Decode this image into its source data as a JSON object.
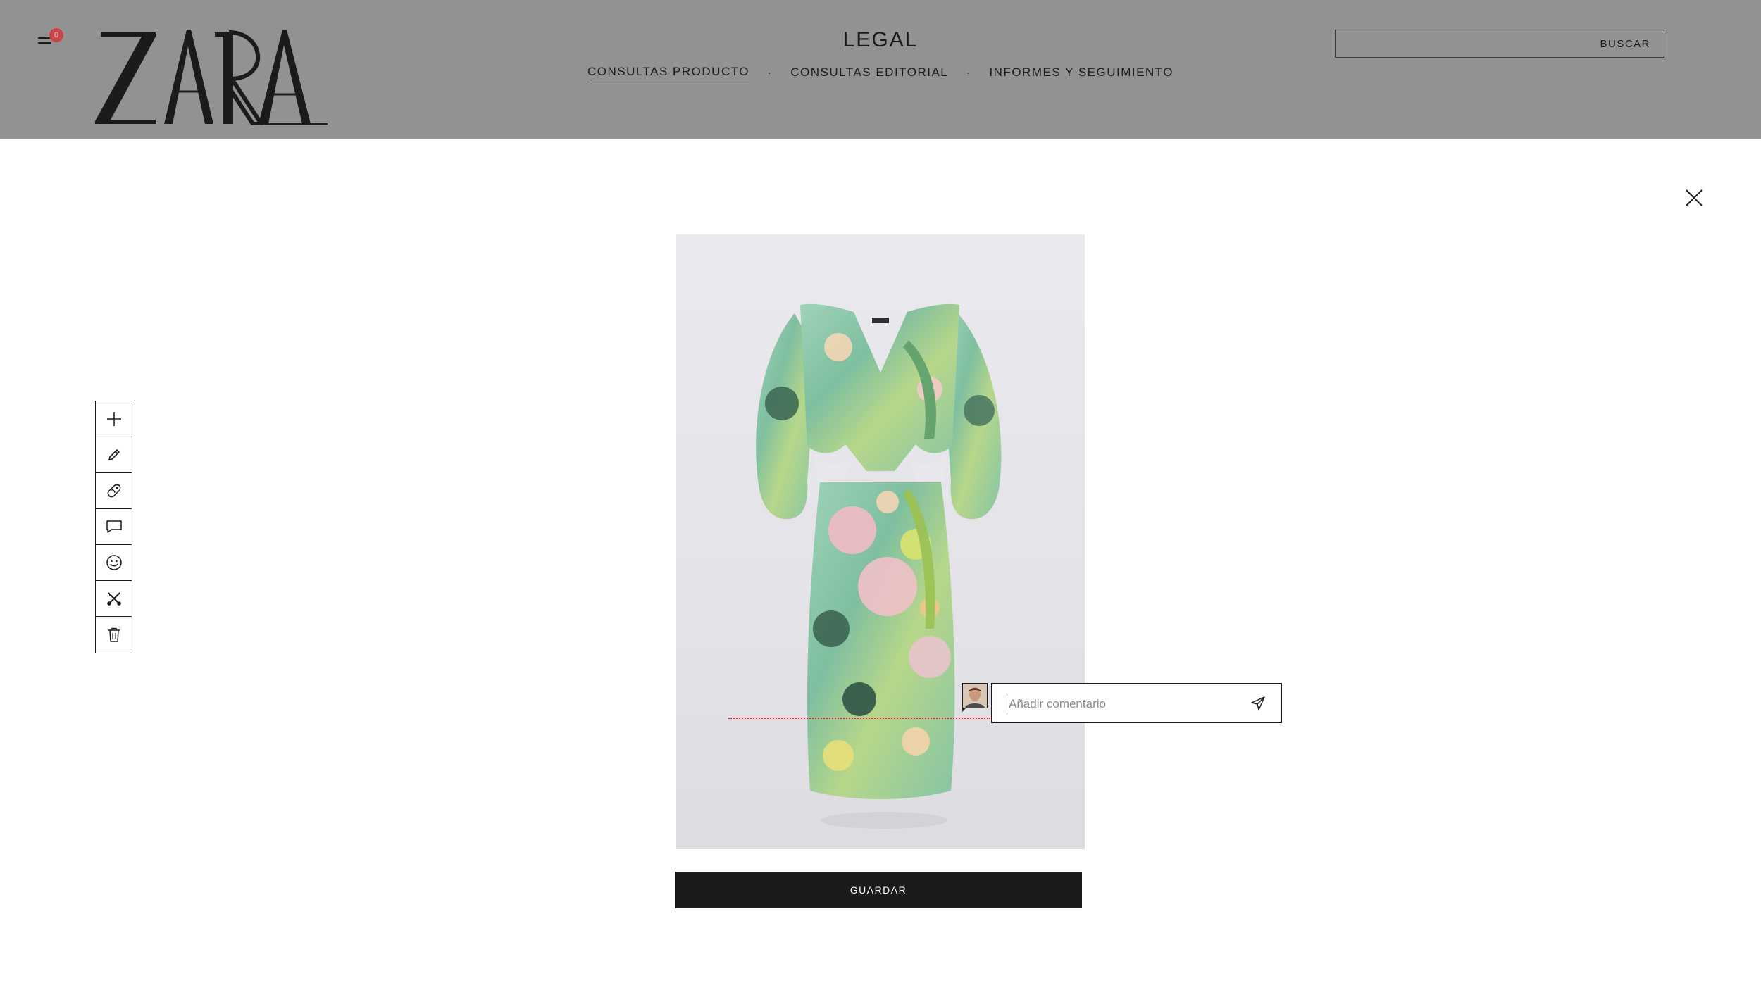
{
  "header": {
    "menu_badge": "0",
    "logo_text": "ZARA",
    "section_title": "LEGAL",
    "nav": [
      {
        "label": "CONSULTAS PRODUCTO",
        "active": true
      },
      {
        "label": "CONSULTAS EDITORIAL",
        "active": false
      },
      {
        "label": "INFORMES Y SEGUIMIENTO",
        "active": false
      }
    ],
    "nav_separator": "·",
    "search": {
      "value": "",
      "button_label": "BUSCAR"
    }
  },
  "toolbar": {
    "tools": [
      {
        "icon": "plus-icon"
      },
      {
        "icon": "pencil-icon"
      },
      {
        "icon": "tag-icon"
      },
      {
        "icon": "comment-icon"
      },
      {
        "icon": "smiley-icon"
      },
      {
        "icon": "scissors-icon"
      },
      {
        "icon": "trash-icon"
      }
    ]
  },
  "product": {
    "image_alt": "floral print patchwork midi dress"
  },
  "comment": {
    "placeholder": "Añadir comentario",
    "value": "",
    "guide_color": "#e0272d"
  },
  "actions": {
    "save_label": "GUARDAR"
  },
  "colors": {
    "header_bg": "#929291",
    "badge": "#c8454a",
    "save_bg": "#1c1a19"
  }
}
